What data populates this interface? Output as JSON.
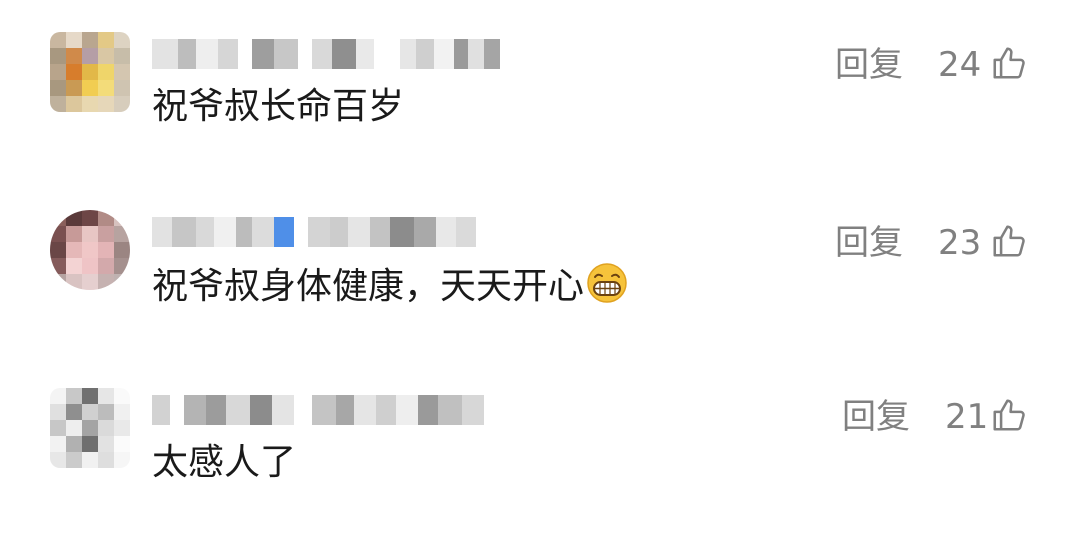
{
  "comments": [
    {
      "username_hidden": true,
      "text": "祝爷叔长命百岁",
      "reply_label": "回复",
      "likes": "24"
    },
    {
      "username_hidden": true,
      "text": "祝爷叔身体健康，天天开心",
      "emoji": "grinning-face-emoji",
      "reply_label": "回复",
      "likes": "23"
    },
    {
      "username_hidden": true,
      "text": "太感人了",
      "reply_label": "回复",
      "likes": "21"
    }
  ],
  "icons": {
    "like": "thumbs-up-icon"
  },
  "colors": {
    "text": "#1a1a1a",
    "meta": "#808080"
  }
}
